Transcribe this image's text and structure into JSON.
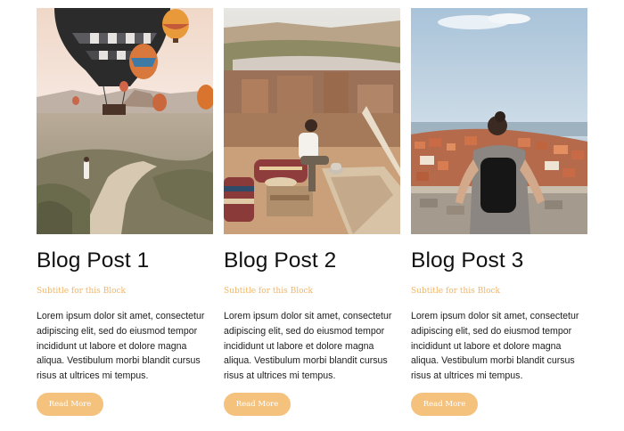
{
  "colors": {
    "accent": "#f5c27d",
    "subtitle": "#f2b568",
    "title": "#111111",
    "body_text": "#1c1c1c",
    "background": "#ffffff"
  },
  "posts": [
    {
      "image_icon": "hot-air-balloons-photo",
      "title": "Blog Post 1",
      "subtitle": "Subtitle for this Block",
      "body": "Lorem ipsum dolor sit amet, consectetur adipiscing elit, sed do eiusmod tempor incididunt ut labore et dolore magna aliqua. Vestibulum morbi blandit cursus risus at ultrices mi tempus.",
      "button_label": "Read More"
    },
    {
      "image_icon": "rooftop-terrace-photo",
      "title": "Blog Post 2",
      "subtitle": "Subtitle for this Block",
      "body": "Lorem ipsum dolor sit amet, consectetur adipiscing elit, sed do eiusmod tempor incididunt ut labore et dolore magna aliqua. Vestibulum morbi blandit cursus risus at ultrices mi tempus.",
      "button_label": "Read More"
    },
    {
      "image_icon": "coastal-city-view-photo",
      "title": "Blog Post 3",
      "subtitle": "Subtitle for this Block",
      "body": "Lorem ipsum dolor sit amet, consectetur adipiscing elit, sed do eiusmod tempor incididunt ut labore et dolore magna aliqua. Vestibulum morbi blandit cursus risus at ultrices mi tempus.",
      "button_label": "Read More"
    }
  ]
}
